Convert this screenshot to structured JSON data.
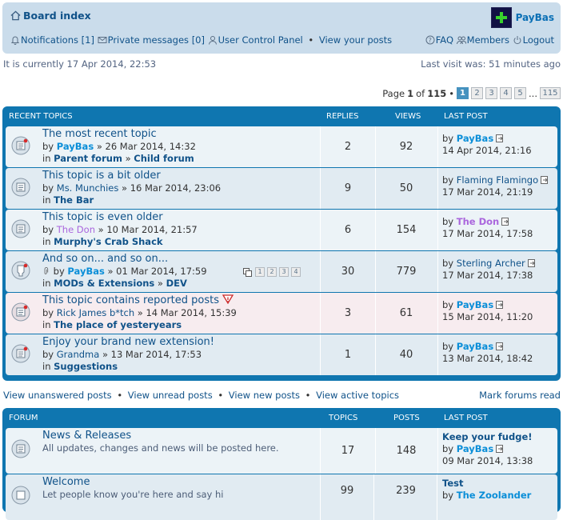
{
  "header": {
    "board_index": "Board index",
    "username": "PayBas",
    "notifications_label": "Notifications",
    "notifications_count": "[1]",
    "pm_label": "Private messages",
    "pm_count": "[0]",
    "ucp": "User Control Panel",
    "view_posts": "View your posts",
    "faq": "FAQ",
    "members": "Members",
    "logout": "Logout"
  },
  "timebar": {
    "current": "It is currently 17 Apr 2014, 22:53",
    "last_visit": "Last visit was: 51 minutes ago"
  },
  "pagination": {
    "page_word": "Page",
    "current": "1",
    "of_word": "of",
    "total": "115",
    "pages": [
      "1",
      "2",
      "3",
      "4",
      "5"
    ],
    "ellipsis": "...",
    "last": "115"
  },
  "recent": {
    "headers": {
      "topic": "RECENT TOPICS",
      "replies": "REPLIES",
      "views": "VIEWS",
      "last_post": "LAST POST"
    },
    "topics": [
      {
        "title": "The most recent topic",
        "by": "by",
        "author": "PayBas",
        "date": "» 26 Mar 2014, 14:32",
        "in": "in",
        "forum1": "Parent forum",
        "forum_sep": "»",
        "forum2": "Child forum",
        "replies": "2",
        "views": "92",
        "lp_by": "by",
        "lp_author": "PayBas",
        "lp_date": "14 Apr 2014, 21:16"
      },
      {
        "title": "This topic is a bit older",
        "by": "by",
        "author": "Ms. Munchies",
        "date": "» 16 Mar 2014, 23:06",
        "in": "in",
        "forum1": "The Bar",
        "replies": "9",
        "views": "50",
        "lp_by": "by",
        "lp_author": "Flaming Flamingo",
        "lp_date": "17 Mar 2014, 21:19"
      },
      {
        "title": "This topic is even older",
        "by": "by",
        "author": "The Don",
        "date": "» 10 Mar 2014, 21:57",
        "in": "in",
        "forum1": "Murphy's Crab Shack",
        "replies": "6",
        "views": "154",
        "lp_by": "by",
        "lp_author": "The Don",
        "lp_date": "17 Mar 2014, 17:58"
      },
      {
        "title": "And so on... and so on...",
        "by": "by",
        "author": "PayBas",
        "date": "» 01 Mar 2014, 17:59",
        "in": "in",
        "forum1": "MODs & Extensions",
        "forum_sep": "»",
        "forum2": "DEV",
        "replies": "30",
        "views": "779",
        "lp_by": "by",
        "lp_author": "Sterling Archer",
        "lp_date": "17 Mar 2014, 17:38",
        "mini_pages": [
          "1",
          "2",
          "3",
          "4"
        ]
      },
      {
        "title": "This topic contains reported posts",
        "by": "by",
        "author": "Rick James b*tch",
        "date": "» 14 Mar 2014, 15:39",
        "in": "in",
        "forum1": "The place of yesteryears",
        "replies": "3",
        "views": "61",
        "lp_by": "by",
        "lp_author": "PayBas",
        "lp_date": "15 Mar 2014, 11:20"
      },
      {
        "title": "Enjoy your brand new extension!",
        "by": "by",
        "author": "Grandma",
        "date": "» 13 Mar 2014, 17:53",
        "in": "in",
        "forum1": "Suggestions",
        "replies": "1",
        "views": "40",
        "lp_by": "by",
        "lp_author": "PayBas",
        "lp_date": "13 Mar 2014, 18:42"
      }
    ]
  },
  "actions": {
    "unanswered": "View unanswered posts",
    "unread": "View unread posts",
    "new": "View new posts",
    "active": "View active topics",
    "mark": "Mark forums read"
  },
  "forums": {
    "headers": {
      "forum": "FORUM",
      "topics": "TOPICS",
      "posts": "POSTS",
      "last_post": "LAST POST"
    },
    "items": [
      {
        "name": "News & Releases",
        "desc": "All updates, changes and news will be posted here.",
        "topics": "17",
        "posts": "148",
        "lp_title": "Keep your fudge!",
        "lp_by": "by",
        "lp_author": "PayBas",
        "lp_date": "09 Mar 2014, 13:38"
      },
      {
        "name": "Welcome",
        "desc": "Let people know you're here and say hi",
        "topics": "99",
        "posts": "239",
        "lp_title": "Test",
        "lp_by": "by",
        "lp_author": "The Zoolander",
        "lp_date": ""
      }
    ]
  },
  "colors": {
    "accent": "#0f76b0",
    "header_bg": "#cadceb",
    "row1": "#ecf3f7",
    "row2": "#e1ebf2",
    "reported": "#f7ecef"
  }
}
